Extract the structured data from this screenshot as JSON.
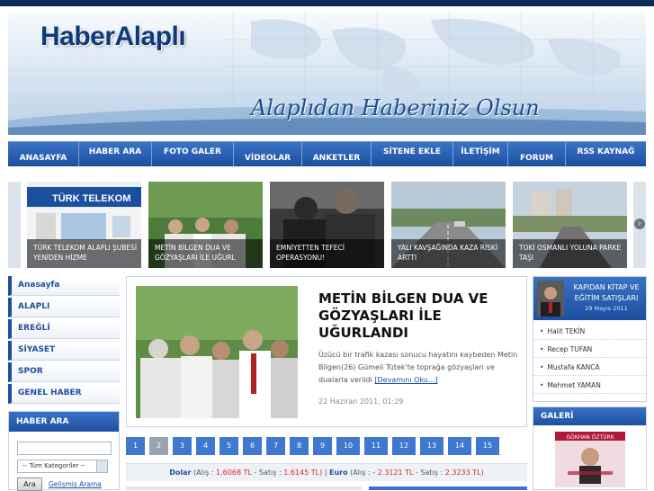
{
  "site": {
    "logo": "HaberAlaplı",
    "slogan": "Alaplıdan Haberiniz Olsun"
  },
  "nav": {
    "items": [
      {
        "label": "ANASAYFA"
      },
      {
        "label": "HABER ARA"
      },
      {
        "label": "FOTO GALER"
      },
      {
        "label": "VİDEOLAR"
      },
      {
        "label": "ANKETLER"
      },
      {
        "label": "SİTENE EKLE"
      },
      {
        "label": "İLETİŞİM"
      },
      {
        "label": "FORUM"
      },
      {
        "label": "RSS KAYNAĞ"
      }
    ]
  },
  "slider": {
    "items": [
      {
        "caption": "TÜRK TELEKOM ALAPLI ŞUBESİ YENİDEN HİZME",
        "sign": "TÜRK TELEKOM"
      },
      {
        "caption": "METİN BİLGEN DUA VE GÖZYAŞLARI İLE UĞURL"
      },
      {
        "caption": "EMNİYETTEN TEFECİ OPERASYONU!"
      },
      {
        "caption": "YALI KAVŞAĞINDA KAZA RİSKİ ARTTI"
      },
      {
        "caption": "TOKİ OSMANLI YOLUNA PARKE TAŞI"
      }
    ]
  },
  "left_menu": {
    "items": [
      "Anasayfa",
      "ALAPLI",
      "EREĞLİ",
      "SİYASET",
      "SPOR",
      "GENEL HABER"
    ]
  },
  "search": {
    "title": "HABER ARA",
    "category_default": "-- Tüm Kategoriler --",
    "button": "Ara",
    "advanced_link": "Gelişmiş Arama"
  },
  "featured": {
    "title": "METİN BİLGEN DUA VE GÖZYAŞLARI İLE UĞURLANDI",
    "body": "Üzücü bir trafik kazası sonucu hayatını kaybeden Metin Bilgen(26) Gümeli Tütek'te toprağa gözyaşları ve dualarla verildi",
    "more": "[Devamını Oku...]",
    "date": "22 Haziran 2011, 01:29"
  },
  "pager": {
    "pages": [
      "1",
      "2",
      "3",
      "4",
      "5",
      "6",
      "7",
      "8",
      "9",
      "10",
      "11",
      "12",
      "13",
      "14",
      "15"
    ],
    "current": "2"
  },
  "currency": {
    "dolar_label": "Dolar",
    "dolar_alis_label": "(Alış : ",
    "dolar_alis": "1.6068 TL",
    "dolar_satis_label": " - Satış : ",
    "dolar_satis": "1.6145 TL)",
    "separator": " | ",
    "euro_label": "Euro",
    "euro_alis_label": " (Alış : ",
    "euro_alis": "- 2.3121 TL",
    "euro_satis_label": " - Satış : ",
    "euro_satis": "2.3233 TL)"
  },
  "kitap": {
    "title": "KAPIDAN KİTAP VE EĞİTİM SATIŞLARI",
    "date": "29 Mayıs 2011"
  },
  "writers": [
    "Halit TEKİN",
    "Recep TUFAN",
    "Mustafa KANCA",
    "Mehmet YAMAN"
  ],
  "galeri": {
    "title": "GALERİ",
    "poster_name": "GÖKHAN ÖZTÜRK"
  },
  "colors": {
    "brand_blue": "#1d4f9f",
    "accent_blue": "#3a72c6",
    "currency_value": "#dd2222"
  }
}
